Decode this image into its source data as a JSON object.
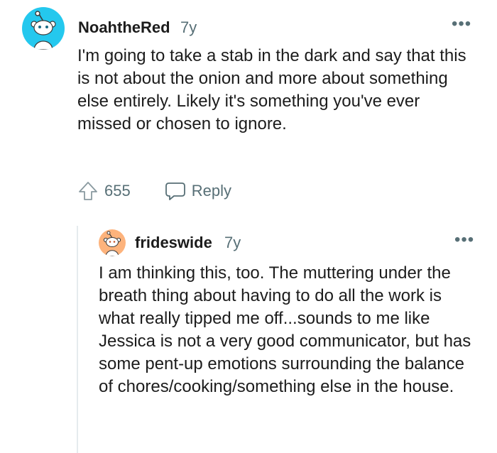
{
  "comments": [
    {
      "username": "NoahtheRed",
      "age": "7y",
      "body": "I'm going to take a stab in the dark and say that this is not about the onion and more about something else entirely. Likely it's something you've ever missed or chosen to ignore.",
      "score": "655",
      "reply_label": "Reply",
      "more_label": "•••",
      "avatar_color": "#24c8ee",
      "icons": {
        "upvote": "upvote-icon",
        "reply": "comment-bubble-icon",
        "more": "overflow-menu-icon"
      }
    },
    {
      "username": "frideswide",
      "age": "7y",
      "body": "I am thinking this, too. The muttering under the breath thing about having to do all the work is what really tipped me off...sounds to me like Jessica is not a very good communicator, but has some pent-up emotions surrounding the balance of chores/cooking/something else in the house.",
      "more_label": "•••",
      "avatar_color": "#fdb37c"
    }
  ],
  "colors": {
    "text": "#1c1c1c",
    "meta": "#576f76",
    "thread_line": "#e5ebee"
  }
}
